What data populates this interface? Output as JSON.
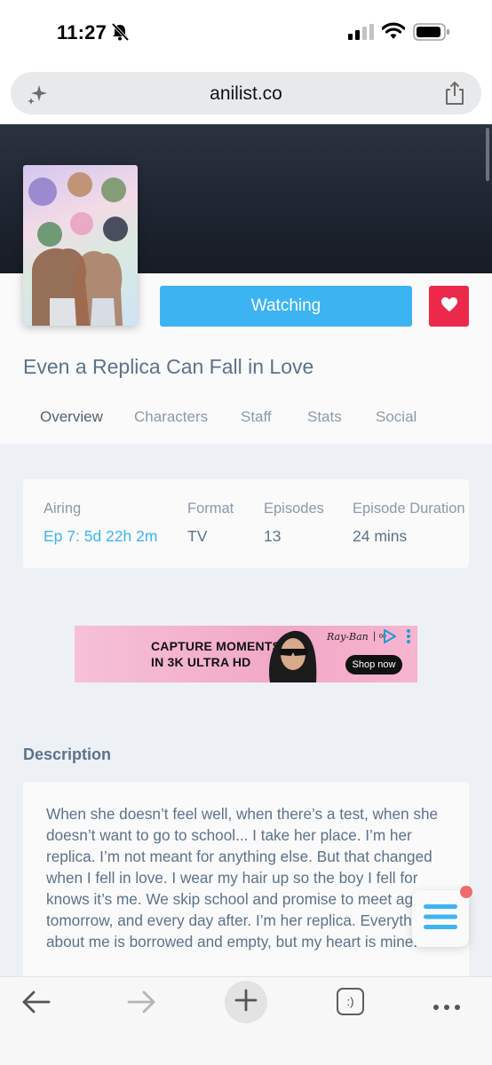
{
  "status_bar": {
    "time": "11:27"
  },
  "browser": {
    "url": "anilist.co",
    "tabs_label": ":)"
  },
  "anime": {
    "title": "Even a Replica Can Fall in Love",
    "status_button": "Watching",
    "tabs": [
      {
        "label": "Overview",
        "active": true
      },
      {
        "label": "Characters",
        "active": false
      },
      {
        "label": "Staff",
        "active": false
      },
      {
        "label": "Stats",
        "active": false
      },
      {
        "label": "Social",
        "active": false
      }
    ]
  },
  "info": {
    "airing_label": "Airing",
    "airing_value": "Ep 7: 5d 22h 2m",
    "format_label": "Format",
    "format_value": "TV",
    "episodes_label": "Episodes",
    "episodes_value": "13",
    "duration_label": "Episode Duration",
    "duration_value": "24 mins"
  },
  "ad": {
    "headline_line1": "CAPTURE MOMENTS",
    "headline_line2": "IN 3K ULTRA HD",
    "brand": "Ray-Ban",
    "meta": "| ∞",
    "cta": "Shop now"
  },
  "description": {
    "heading": "Description",
    "text": "When she doesn’t feel well, when there’s a test, when she doesn’t want to go to school... I take her place. I’m her replica. I’m not meant for anything else. But that changed when I fell in love. I wear my hair up so the boy I fell for knows it’s me. We skip school and promise to meet again tomorrow, and every day after. I’m her replica. Everything about me is borrowed and empty, but my heart is mine."
  },
  "colors": {
    "accent_blue": "#3db4f2",
    "favorite_red": "#ec294b",
    "text_primary": "#5c728a",
    "text_muted": "#8c9aaa",
    "banner_dark": "#1c222d",
    "page_bg": "#edf1f5",
    "notification_dot": "#ef6c6c"
  },
  "icons": {
    "status_bell": "bell-slash-icon",
    "url_left": "sparkle-icon",
    "url_right": "share-icon",
    "favorite": "heart-icon",
    "menu": "hamburger-menu-icon",
    "back": "arrow-left-icon",
    "forward": "arrow-right-icon",
    "new_tab": "plus-icon",
    "more": "more-dots-icon"
  }
}
